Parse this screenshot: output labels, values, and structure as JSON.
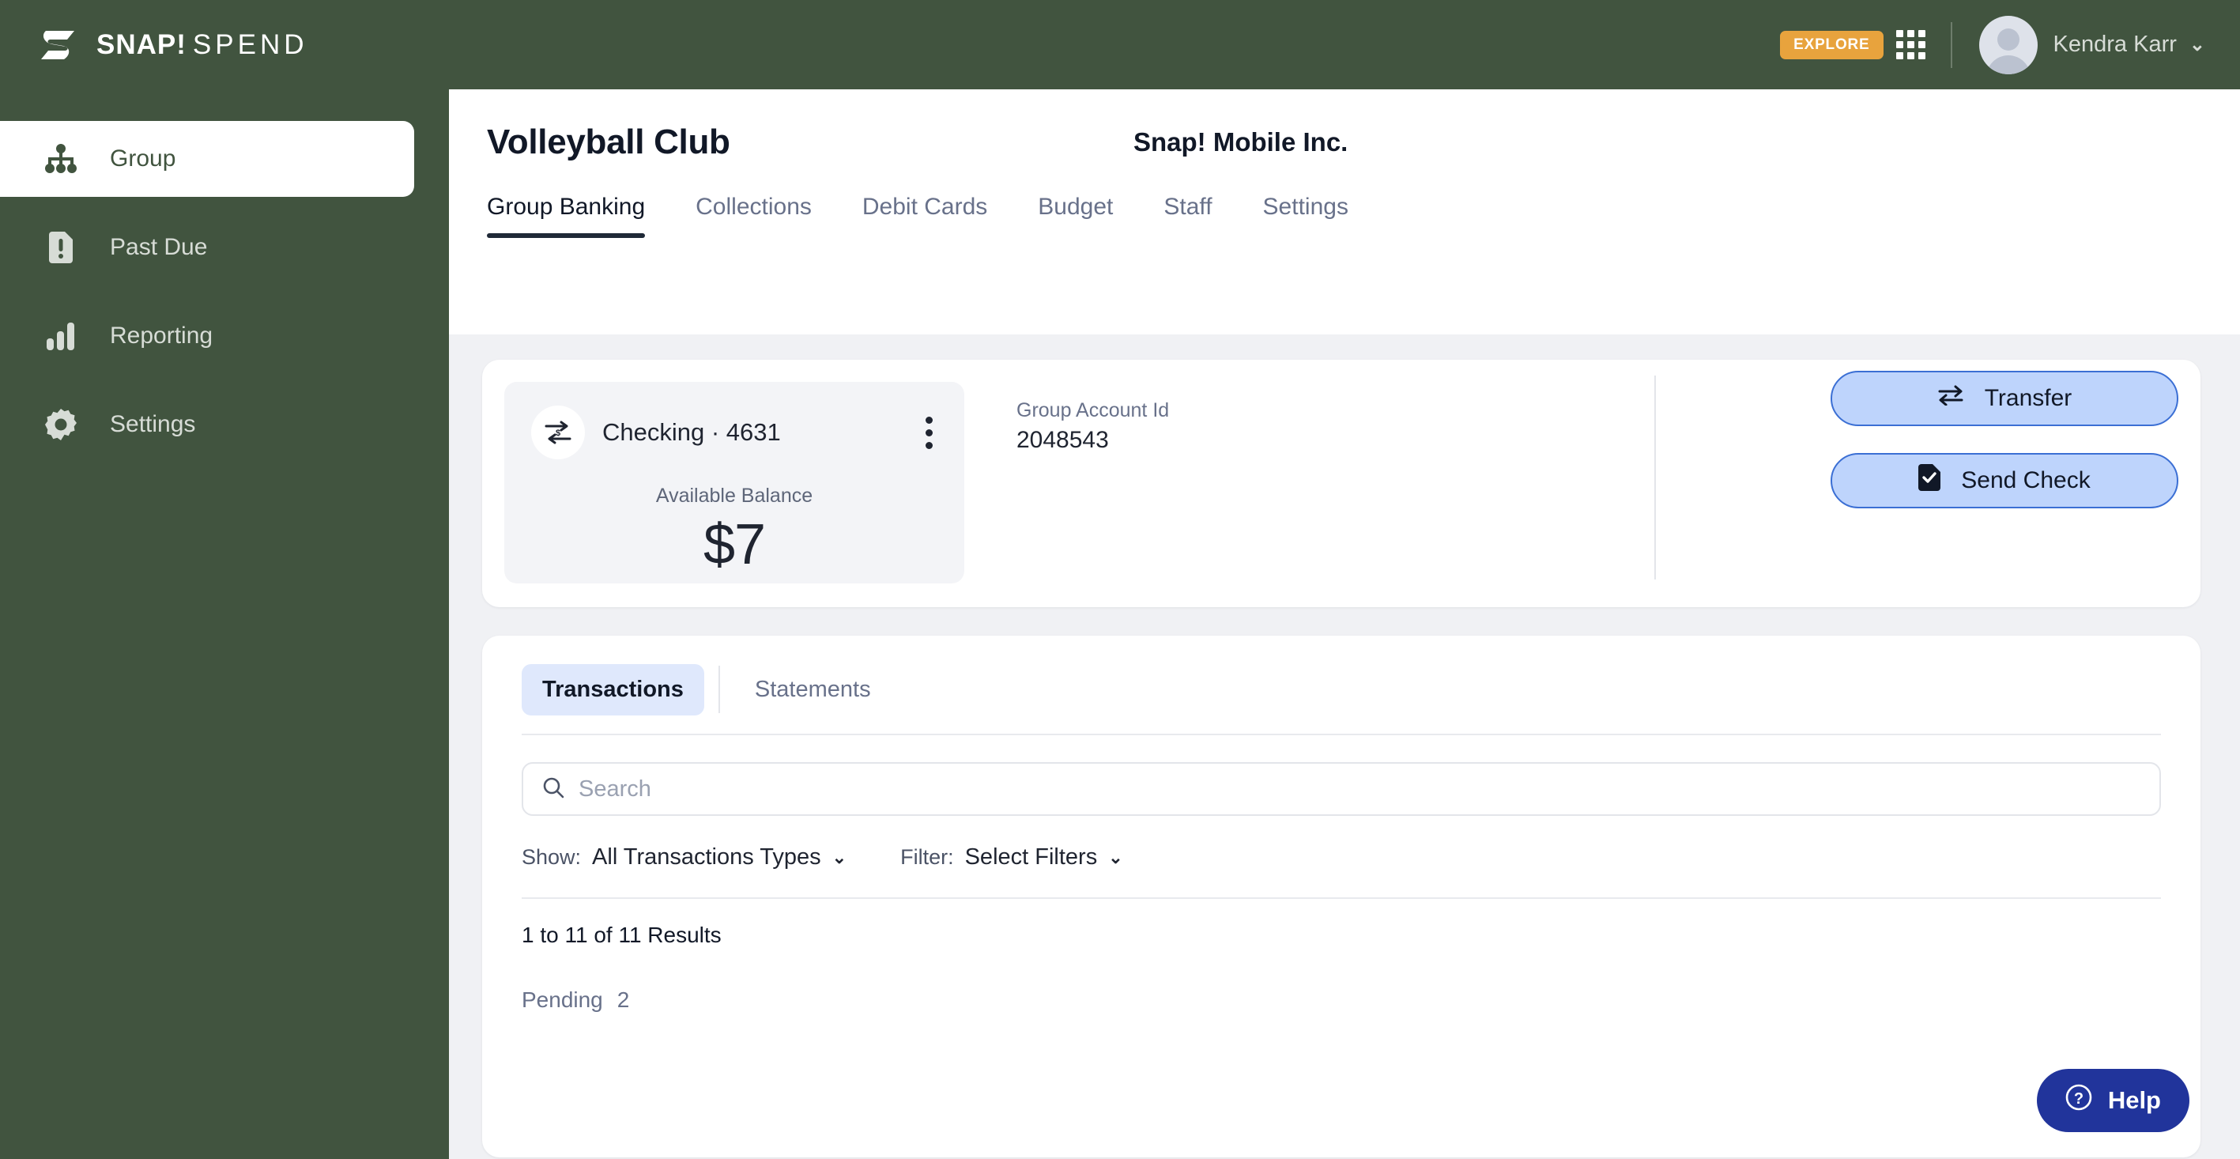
{
  "brand": {
    "name_bold": "SNAP!",
    "name_thin": "SPEND",
    "logo_icon": "snap-s-logo"
  },
  "topbar": {
    "explore_label": "EXPLORE",
    "apps_icon": "apps-grid-icon",
    "user_name": "Kendra Karr",
    "user_chevron": "⌄",
    "avatar_icon": "user-avatar-icon",
    "background": "#41543F"
  },
  "sidebar": {
    "items": [
      {
        "label": "Group",
        "icon": "org-chart-icon",
        "active": true
      },
      {
        "label": "Past Due",
        "icon": "alert-document-icon",
        "active": false
      },
      {
        "label": "Reporting",
        "icon": "bar-chart-icon",
        "active": false
      },
      {
        "label": "Settings",
        "icon": "gear-icon",
        "active": false
      }
    ]
  },
  "page": {
    "title": "Volleyball Club",
    "org_name": "Snap! Mobile Inc.",
    "tabs": [
      {
        "label": "Group Banking",
        "active": true
      },
      {
        "label": "Collections",
        "active": false
      },
      {
        "label": "Debit Cards",
        "active": false
      },
      {
        "label": "Budget",
        "active": false
      },
      {
        "label": "Staff",
        "active": false
      },
      {
        "label": "Settings",
        "active": false
      }
    ]
  },
  "account": {
    "icon": "transfer-dollar-icon",
    "name": "Checking · 4631",
    "kebab_icon": "more-vertical-icon",
    "balance_label": "Available Balance",
    "balance_amount": "$7",
    "group_account_id_label": "Group Account Id",
    "group_account_id_value": "2048543",
    "actions": [
      {
        "label": "Transfer",
        "icon": "transfer-arrows-icon"
      },
      {
        "label": "Send Check",
        "icon": "check-document-icon"
      }
    ],
    "accent_button_bg": "#BED4FC",
    "accent_button_border": "#3B6FD4"
  },
  "transactions": {
    "segments": [
      {
        "label": "Transactions",
        "active": true
      },
      {
        "label": "Statements",
        "active": false
      }
    ],
    "search": {
      "icon": "search-icon",
      "value": "",
      "placeholder": "Search"
    },
    "show_label": "Show:",
    "show_value": "All Transactions Types",
    "filter_label": "Filter:",
    "filter_value": "Select Filters",
    "chevron": "⌄",
    "results_text": "1 to 11 of 11 Results",
    "pending_label": "Pending",
    "pending_count": "2"
  },
  "help": {
    "label": "Help",
    "icon": "question-circle-icon",
    "color": "#21349B"
  }
}
